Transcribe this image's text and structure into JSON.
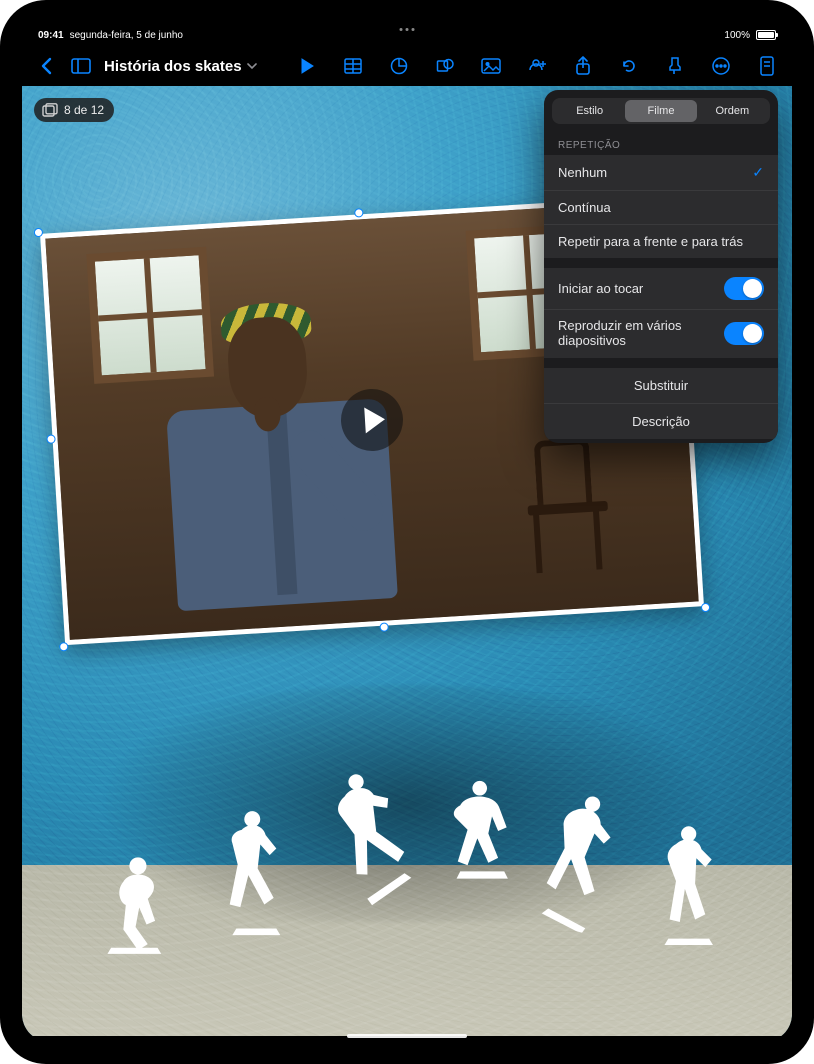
{
  "status": {
    "time": "09:41",
    "date": "segunda-feira, 5 de junho",
    "battery_pct": "100%"
  },
  "toolbar": {
    "back_icon": "chevron-left",
    "title": "História dos skates"
  },
  "slide_badge": {
    "text": "8 de 12"
  },
  "popover": {
    "tabs": {
      "style": "Estilo",
      "movie": "Filme",
      "order": "Ordem",
      "active": "movie"
    },
    "repeat_section_label": "REPETIÇÃO",
    "repeat_options": {
      "none": "Nenhum",
      "continuous": "Contínua",
      "fwd_back": "Repetir para a frente e para trás",
      "selected": "none"
    },
    "toggles": {
      "start_on_tap": {
        "label": "Iniciar ao tocar",
        "on": true
      },
      "play_across_slides": {
        "label": "Reproduzir em vários diapositivos",
        "on": true
      }
    },
    "actions": {
      "replace": "Substituir",
      "description": "Descrição"
    }
  }
}
